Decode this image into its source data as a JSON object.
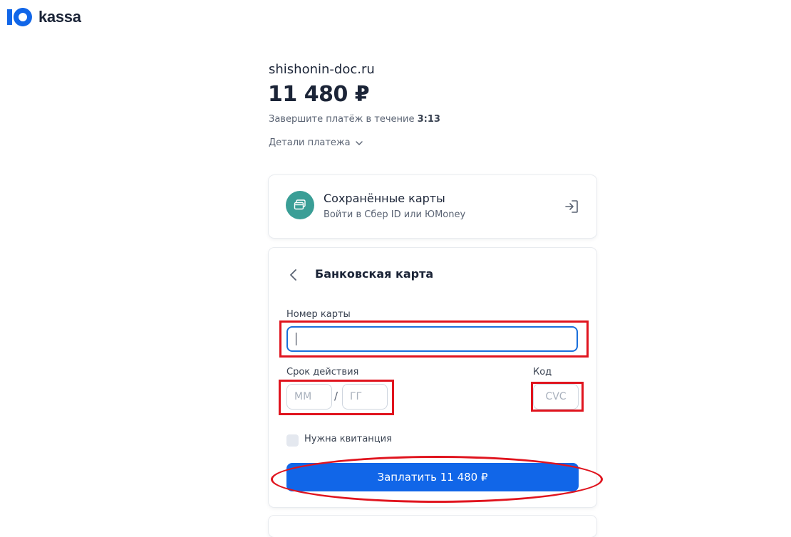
{
  "brand": {
    "logo_text": "kassa",
    "accent": "#1166e8"
  },
  "header": {
    "shop_name": "shishonin-doc.ru",
    "amount": "11 480 ₽",
    "timer_prefix": "Завершите платёж в течение",
    "timer_value": "3:13",
    "details_label": "Детали платежа"
  },
  "saved_cards": {
    "title": "Сохранённые карты",
    "subtitle": "Войти в Сбер ID или ЮMoney",
    "icon": "card-icon"
  },
  "bank_card": {
    "title": "Банковская карта",
    "card_number_label": "Номер карты",
    "card_number_value": "",
    "expiry_label": "Срок действия",
    "month_placeholder": "ММ",
    "year_placeholder": "ГГ",
    "slash": "/",
    "code_label": "Код",
    "cvc_placeholder": "CVC",
    "receipt_label": "Нужна квитанция",
    "pay_label": "Заплатить 11 480 ₽"
  },
  "colors": {
    "highlight": "#e0141e",
    "saved_icon_bg": "#3a9e96",
    "focus_border": "#1a6fdb"
  }
}
